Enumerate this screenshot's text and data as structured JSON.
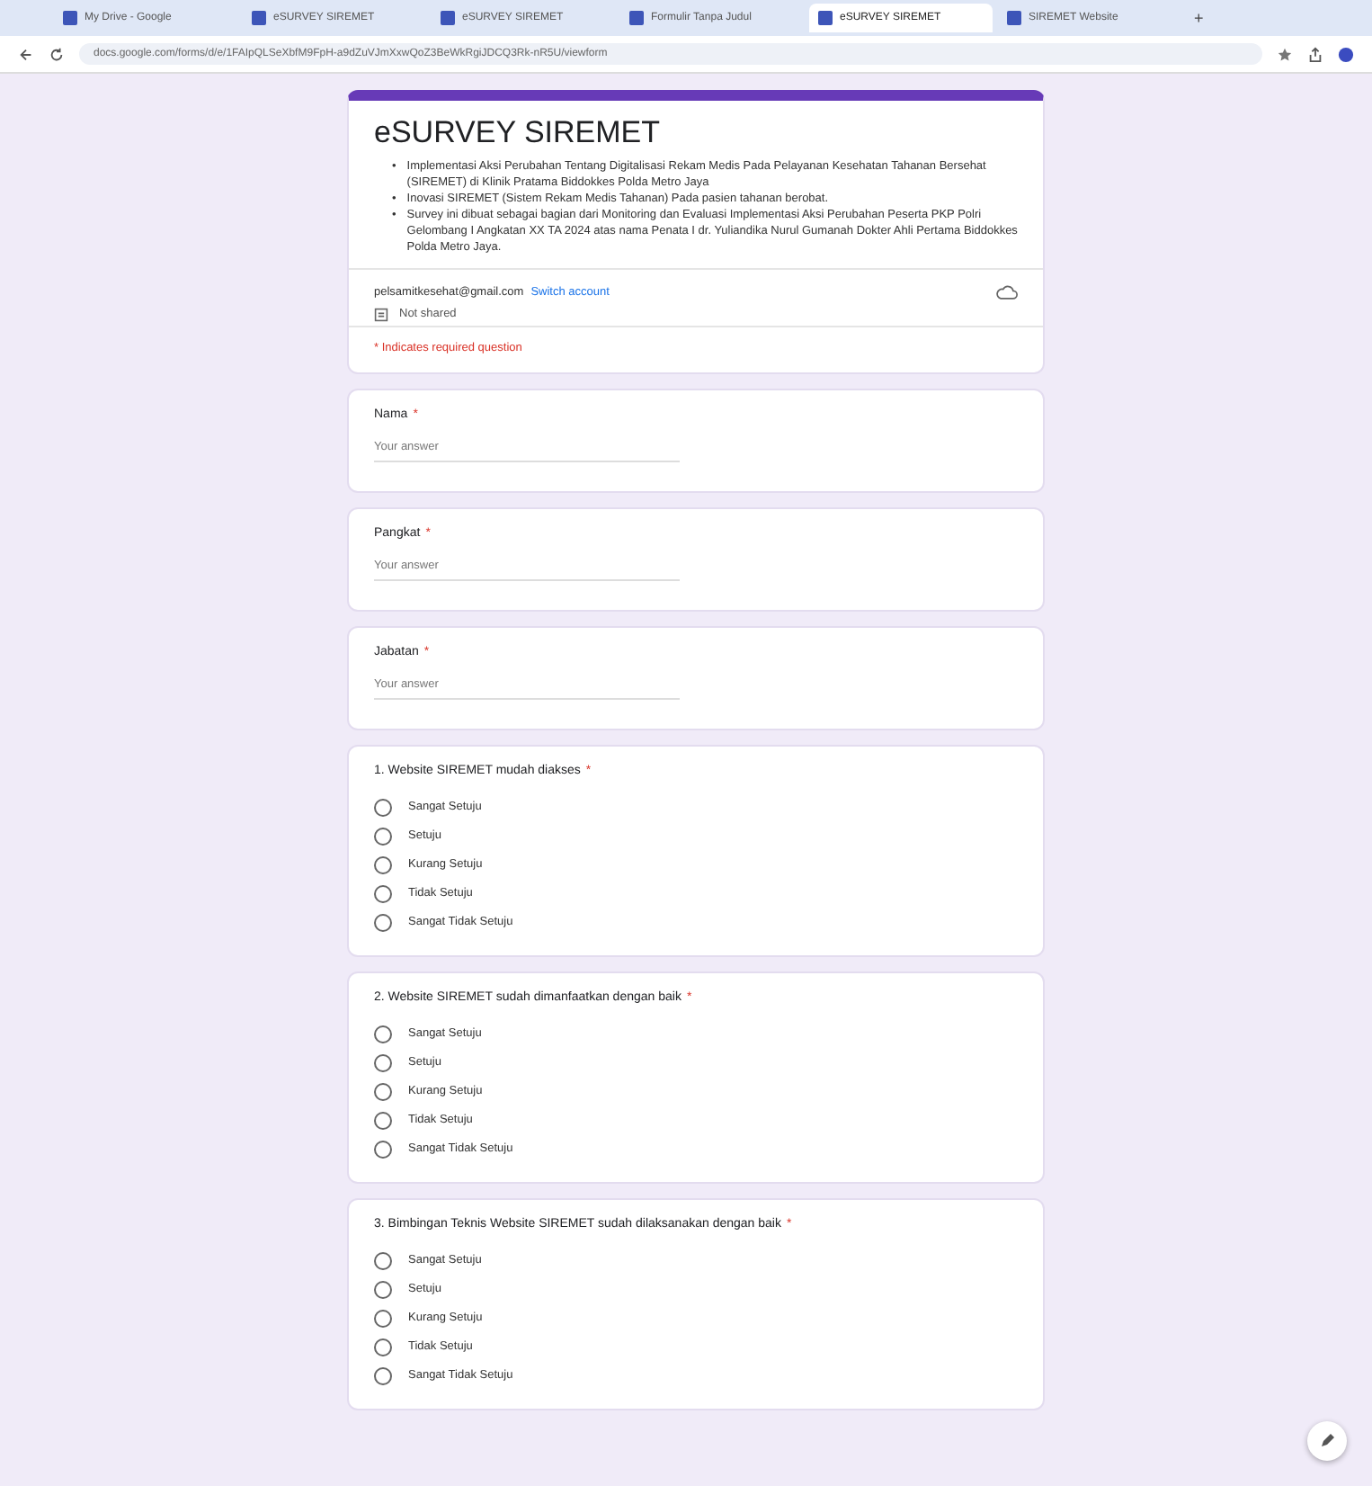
{
  "browser": {
    "tabs": [
      {
        "label": "My Drive - Google",
        "selected": false
      },
      {
        "label": "eSURVEY SIREMET",
        "selected": false
      },
      {
        "label": "eSURVEY SIREMET",
        "selected": false
      },
      {
        "label": "Formulir Tanpa Judul",
        "selected": false
      },
      {
        "label": "eSURVEY SIREMET",
        "selected": true
      },
      {
        "label": "SIREMET Website",
        "selected": false
      }
    ],
    "new_tab": "+",
    "url": "docs.google.com/forms/d/e/1FAIpQLSeXbfM9FpH-a9dZuVJmXxwQoZ3BeWkRgiJDCQ3Rk-nR5U/viewform"
  },
  "form": {
    "title": "eSURVEY SIREMET",
    "bullet": "•",
    "required_mark": "*",
    "description": [
      "Implementasi Aksi Perubahan Tentang Digitalisasi Rekam Medis Pada Pelayanan Kesehatan Tahanan Bersehat (SIREMET) di Klinik Pratama Biddokkes Polda Metro Jaya",
      "Inovasi SIREMET (Sistem Rekam Medis Tahanan) Pada pasien tahanan berobat.",
      "Survey ini dibuat sebagai bagian dari Monitoring dan Evaluasi Implementasi Aksi Perubahan Peserta PKP Polri Gelombang I Angkatan XX TA 2024 atas nama Penata I dr. Yuliandika Nurul Gumanah Dokter Ahli Pertama Biddokkes Polda Metro Jaya."
    ],
    "account": "pelsamitkesehat@gmail.com",
    "switch_account": "Switch account",
    "not_shared": "Not shared",
    "required_note": "* Indicates required question",
    "questions": [
      {
        "kind": "text",
        "title": "Nama",
        "required": true,
        "placeholder": "Your answer"
      },
      {
        "kind": "text",
        "title": "Pangkat",
        "required": true,
        "placeholder": "Your answer"
      },
      {
        "kind": "text",
        "title": "Jabatan",
        "required": true,
        "placeholder": "Your answer"
      },
      {
        "kind": "choice",
        "title": "1. Website SIREMET mudah diakses",
        "required": true,
        "options": [
          {
            "label": "Sangat Setuju",
            "selected": false
          },
          {
            "label": "Setuju",
            "selected": false
          },
          {
            "label": "Kurang Setuju",
            "selected": false
          },
          {
            "label": "Tidak Setuju",
            "selected": false
          },
          {
            "label": "Sangat Tidak Setuju",
            "selected": false
          }
        ]
      },
      {
        "kind": "choice",
        "title": "2. Website SIREMET sudah dimanfaatkan dengan baik",
        "required": true,
        "options": [
          {
            "label": "Sangat Setuju",
            "selected": false
          },
          {
            "label": "Setuju",
            "selected": false
          },
          {
            "label": "Kurang Setuju",
            "selected": false
          },
          {
            "label": "Tidak Setuju",
            "selected": false
          },
          {
            "label": "Sangat Tidak Setuju",
            "selected": false
          }
        ]
      },
      {
        "kind": "choice",
        "title": "3. Bimbingan Teknis Website SIREMET sudah dilaksanakan dengan baik",
        "required": true,
        "options": [
          {
            "label": "Sangat Setuju",
            "selected": false
          },
          {
            "label": "Setuju",
            "selected": false
          },
          {
            "label": "Kurang Setuju",
            "selected": false
          },
          {
            "label": "Tidak Setuju",
            "selected": false
          },
          {
            "label": "Sangat Tidak Setuju",
            "selected": false
          }
        ]
      }
    ]
  }
}
